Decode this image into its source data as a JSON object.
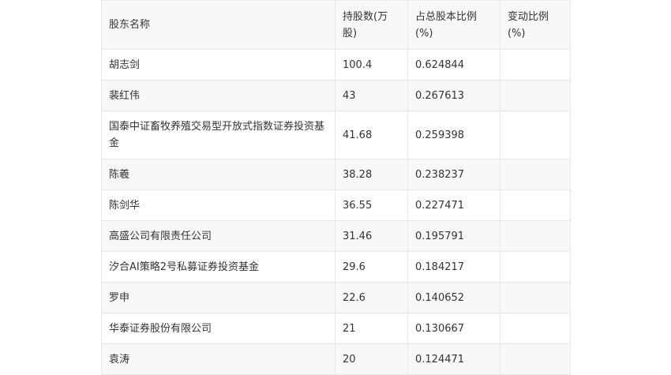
{
  "table": {
    "headers": [
      "股东名称",
      "持股数(万股)",
      "占总股本比例(%)",
      "变动比例(%)"
    ],
    "rows": [
      [
        "胡志剑",
        "100.4",
        "0.624844",
        ""
      ],
      [
        "裴红伟",
        "43",
        "0.267613",
        ""
      ],
      [
        "国泰中证畜牧养殖交易型开放式指数证券投资基金",
        "41.68",
        "0.259398",
        ""
      ],
      [
        "陈羲",
        "38.28",
        "0.238237",
        ""
      ],
      [
        "陈剑华",
        "36.55",
        "0.227471",
        ""
      ],
      [
        "高盛公司有限责任公司",
        "31.46",
        "0.195791",
        ""
      ],
      [
        "汐合AI策略2号私募证券投资基金",
        "29.6",
        "0.184217",
        ""
      ],
      [
        "罗申",
        "22.6",
        "0.140652",
        ""
      ],
      [
        "华泰证券股份有限公司",
        "21",
        "0.130667",
        ""
      ],
      [
        "袁涛",
        "20",
        "0.124471",
        ""
      ]
    ]
  }
}
